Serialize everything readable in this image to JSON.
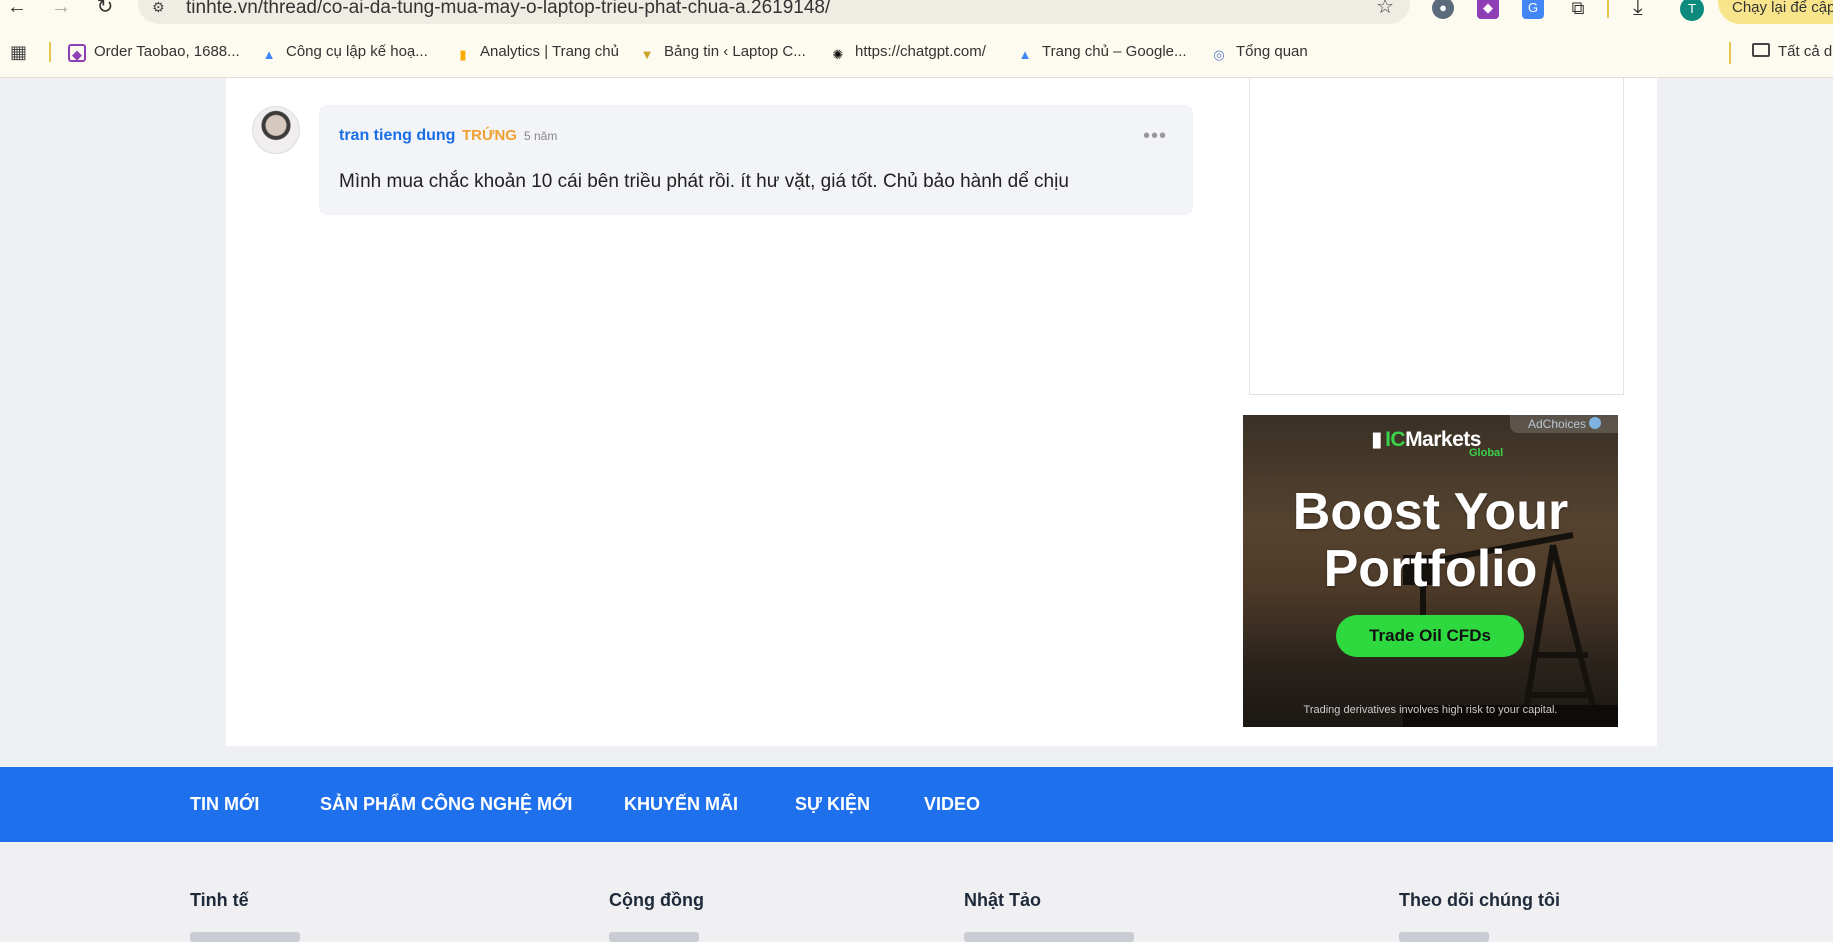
{
  "browser": {
    "url": "tinhte.vn/thread/co-ai-da-tung-mua-may-o-laptop-trieu-phat-chua-a.2619148/",
    "update_button": "Chạy lại để cập",
    "profile_initial": "T",
    "bookmarks": [
      {
        "label": "Order Taobao, 1688...",
        "icon": "box-icon",
        "color": "#8e3fb5"
      },
      {
        "label": "Công cụ lập kế hoạ...",
        "icon": "google-ads-icon",
        "color": "#4285f4"
      },
      {
        "label": "Analytics | Trang chủ",
        "icon": "analytics-icon",
        "color": "#f9ab00"
      },
      {
        "label": "Bảng tin ‹ Laptop C...",
        "icon": "dashboard-icon",
        "color": "#c9a227"
      },
      {
        "label": "https://chatgpt.com/",
        "icon": "chatgpt-icon",
        "color": "#111111"
      },
      {
        "label": "Trang chủ – Google...",
        "icon": "google-ads-icon",
        "color": "#4285f4"
      },
      {
        "label": "Tổng quan",
        "icon": "overview-icon",
        "color": "#5b7bd5"
      }
    ],
    "all_bookmarks": "Tất cả d"
  },
  "comment": {
    "author": "tran tieng dung",
    "rank": "TRỨNG",
    "time": "5 năm",
    "text": "Mình mua chắc khoản 10 cái bên triều phát rồi. ít hư vặt, giá tốt. Chủ bảo hành dể chịu"
  },
  "ad": {
    "adchoices": "AdChoices",
    "brand_ic": "IC",
    "brand_rest": "Markets",
    "brand_sub": "Global",
    "headline_line1": "Boost Your",
    "headline_line2": "Portfolio",
    "cta": "Trade Oil CFDs",
    "disclaimer": "Trading derivatives involves high risk to your capital."
  },
  "nav": {
    "items": [
      "TIN MỚI",
      "SẢN PHẨM CÔNG NGHỆ MỚI",
      "KHUYẾN MÃI",
      "SỰ KIỆN",
      "VIDEO"
    ]
  },
  "footer": {
    "columns": [
      "Tinh tế",
      "Cộng đồng",
      "Nhật Tảo",
      "Theo dõi chúng tôi"
    ]
  }
}
